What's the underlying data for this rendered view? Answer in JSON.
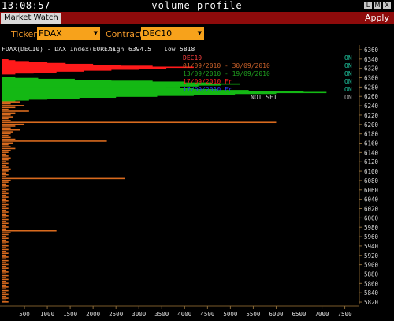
{
  "window": {
    "clock": "13:08:57",
    "title": "volume profile",
    "buttons": [
      "L",
      "M",
      "X"
    ]
  },
  "toolbar": {
    "tab_label": "Market Watch",
    "apply_label": "Apply"
  },
  "params": {
    "ticker_label": "Ticker",
    "ticker_value": "FDAX",
    "contract_label": "Contract",
    "contract_value": "DEC10"
  },
  "colors": {
    "red": "#ff1a1a",
    "green": "#14b814",
    "orange": "#e07820",
    "accent": "#f7a21b",
    "on": "#1fc7a0"
  },
  "chart_data": {
    "type": "bar",
    "orientation": "horizontal",
    "header": "FDAX(DEC10) - DAX Index(EUREX)",
    "high_label": "high",
    "high": "6394.5",
    "low_label": "low",
    "low": "5818",
    "xlim": [
      0,
      7800
    ],
    "ylim": [
      5815,
      6365
    ],
    "xticks": [
      500,
      1000,
      1500,
      2000,
      2500,
      3000,
      3500,
      4000,
      4500,
      5000,
      5500,
      6000,
      6500,
      7000,
      7500
    ],
    "yticks": [
      5820,
      5840,
      5860,
      5880,
      5900,
      5920,
      5940,
      5960,
      5980,
      6000,
      6020,
      6040,
      6060,
      6080,
      6100,
      6120,
      6140,
      6160,
      6180,
      6200,
      6220,
      6240,
      6260,
      6280,
      6300,
      6320,
      6340,
      6360
    ],
    "legend": [
      {
        "text": "DEC10",
        "status": "ON",
        "color": "#ff4040"
      },
      {
        "text": "01/09/2010 - 30/09/2010",
        "status": "ON",
        "color": "#c8602a"
      },
      {
        "text": "13/09/2010 - 19/09/2010",
        "status": "ON",
        "color": "#1f9e1f"
      },
      {
        "text": "17/09/2010 Fr",
        "status": "ON",
        "color": "#ff2020"
      },
      {
        "text": "17/09/2010 Fr",
        "status": "ON",
        "color": "#2a3aff"
      },
      {
        "text": "NOT SET",
        "status": "ON",
        "color": "#cfcfcf"
      }
    ],
    "series": [
      {
        "name": "17/09/2010 Fr",
        "color": "#ff1a1a",
        "points": [
          [
            6338,
            150
          ],
          [
            6336,
            300
          ],
          [
            6334,
            600
          ],
          [
            6332,
            1000
          ],
          [
            6330,
            1400
          ],
          [
            6328,
            2000
          ],
          [
            6326,
            2600
          ],
          [
            6324,
            3300
          ],
          [
            6322,
            4200
          ],
          [
            6320,
            3600
          ],
          [
            6318,
            3000
          ],
          [
            6316,
            2400
          ],
          [
            6314,
            1800
          ],
          [
            6312,
            1200
          ],
          [
            6310,
            700
          ],
          [
            6308,
            300
          ]
        ]
      },
      {
        "name": "13/09/2010 - 19/09/2010",
        "color": "#14b814",
        "points": [
          [
            6300,
            300
          ],
          [
            6298,
            800
          ],
          [
            6296,
            1600
          ],
          [
            6294,
            2400
          ],
          [
            6292,
            3300
          ],
          [
            6290,
            4000
          ],
          [
            6288,
            4600
          ],
          [
            6286,
            5200
          ],
          [
            6284,
            4800
          ],
          [
            6282,
            4300
          ],
          [
            6280,
            3900
          ],
          [
            6278,
            3600
          ],
          [
            6276,
            4200
          ],
          [
            6274,
            4700
          ],
          [
            6272,
            5400
          ],
          [
            6270,
            6600
          ],
          [
            6268,
            7100
          ],
          [
            6266,
            6000
          ],
          [
            6264,
            5100
          ],
          [
            6262,
            4200
          ],
          [
            6260,
            3400
          ],
          [
            6258,
            2500
          ],
          [
            6256,
            1700
          ],
          [
            6254,
            1000
          ],
          [
            6252,
            600
          ],
          [
            6250,
            300
          ]
        ]
      },
      {
        "name": "01/09/2010 - 30/09/2010",
        "color": "#d86a1e",
        "points": [
          [
            6248,
            400
          ],
          [
            6244,
            200
          ],
          [
            6240,
            500
          ],
          [
            6236,
            300
          ],
          [
            6232,
            150
          ],
          [
            6228,
            600
          ],
          [
            6224,
            300
          ],
          [
            6220,
            200
          ],
          [
            6216,
            250
          ],
          [
            6212,
            150
          ],
          [
            6208,
            200
          ],
          [
            6204,
            6000
          ],
          [
            6200,
            500
          ],
          [
            6196,
            300
          ],
          [
            6192,
            200
          ],
          [
            6188,
            400
          ],
          [
            6184,
            250
          ],
          [
            6180,
            200
          ],
          [
            6176,
            150
          ],
          [
            6172,
            200
          ],
          [
            6168,
            300
          ],
          [
            6164,
            2300
          ],
          [
            6160,
            250
          ],
          [
            6156,
            150
          ],
          [
            6152,
            200
          ],
          [
            6148,
            300
          ],
          [
            6144,
            200
          ],
          [
            6140,
            150
          ],
          [
            6136,
            100
          ],
          [
            6132,
            150
          ],
          [
            6128,
            200
          ],
          [
            6124,
            150
          ],
          [
            6120,
            100
          ],
          [
            6116,
            150
          ],
          [
            6112,
            100
          ],
          [
            6108,
            150
          ],
          [
            6104,
            200
          ],
          [
            6100,
            150
          ],
          [
            6096,
            100
          ],
          [
            6092,
            150
          ],
          [
            6088,
            100
          ],
          [
            6084,
            2700
          ],
          [
            6080,
            200
          ],
          [
            6076,
            150
          ],
          [
            6072,
            100
          ],
          [
            6068,
            150
          ],
          [
            6064,
            100
          ],
          [
            6060,
            150
          ],
          [
            6056,
            100
          ],
          [
            6052,
            150
          ],
          [
            6048,
            100
          ],
          [
            6044,
            150
          ],
          [
            6040,
            100
          ],
          [
            6036,
            150
          ],
          [
            6032,
            100
          ],
          [
            6028,
            150
          ],
          [
            6024,
            100
          ],
          [
            6020,
            150
          ],
          [
            6016,
            100
          ],
          [
            6012,
            150
          ],
          [
            6008,
            100
          ],
          [
            6004,
            150
          ],
          [
            6000,
            100
          ],
          [
            5996,
            150
          ],
          [
            5992,
            100
          ],
          [
            5988,
            150
          ],
          [
            5984,
            100
          ],
          [
            5980,
            150
          ],
          [
            5976,
            100
          ],
          [
            5972,
            1200
          ],
          [
            5968,
            200
          ],
          [
            5964,
            150
          ],
          [
            5960,
            100
          ],
          [
            5956,
            150
          ],
          [
            5952,
            100
          ],
          [
            5948,
            150
          ],
          [
            5944,
            100
          ],
          [
            5940,
            150
          ],
          [
            5936,
            100
          ],
          [
            5932,
            150
          ],
          [
            5928,
            100
          ],
          [
            5924,
            150
          ],
          [
            5920,
            100
          ],
          [
            5916,
            150
          ],
          [
            5912,
            100
          ],
          [
            5908,
            150
          ],
          [
            5904,
            100
          ],
          [
            5900,
            150
          ],
          [
            5896,
            100
          ],
          [
            5892,
            150
          ],
          [
            5888,
            100
          ],
          [
            5884,
            150
          ],
          [
            5880,
            100
          ],
          [
            5876,
            150
          ],
          [
            5872,
            100
          ],
          [
            5868,
            150
          ],
          [
            5864,
            100
          ],
          [
            5860,
            150
          ],
          [
            5856,
            100
          ],
          [
            5852,
            150
          ],
          [
            5848,
            100
          ],
          [
            5844,
            150
          ],
          [
            5840,
            100
          ],
          [
            5836,
            150
          ],
          [
            5832,
            100
          ],
          [
            5828,
            150
          ],
          [
            5824,
            100
          ],
          [
            5820,
            150
          ]
        ]
      }
    ]
  }
}
